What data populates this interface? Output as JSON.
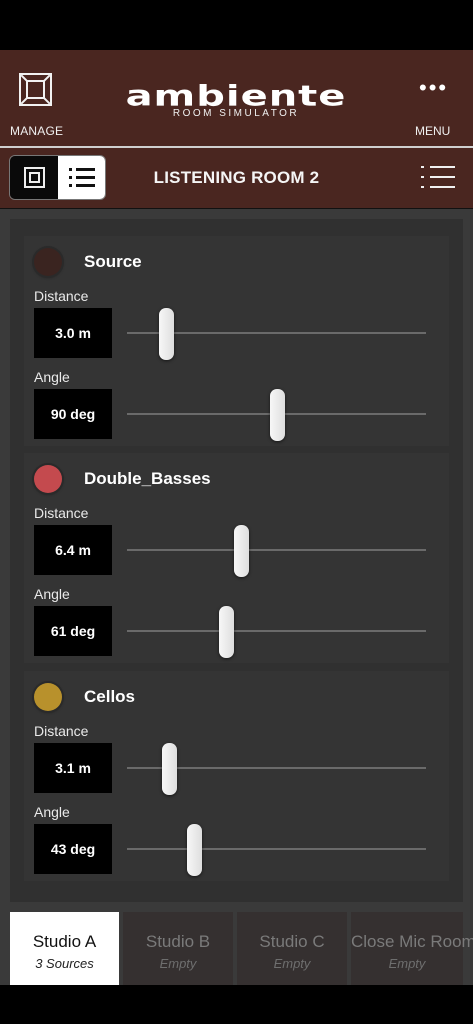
{
  "header": {
    "manage_label": "MANAGE",
    "logo_text": "ambiente",
    "logo_subtitle": "ROOM SIMULATOR",
    "menu_label": "MENU",
    "menu_glyph": "•••"
  },
  "room": {
    "title": "LISTENING ROOM 2"
  },
  "sources": [
    {
      "name": "Source",
      "color": "#3a2420",
      "distance": {
        "label": "Distance",
        "value": "3.0 m",
        "fraction": 0.13
      },
      "angle": {
        "label": "Angle",
        "value": "90 deg",
        "fraction": 0.5
      }
    },
    {
      "name": "Double_Basses",
      "color": "#c44a4e",
      "distance": {
        "label": "Distance",
        "value": "6.4 m",
        "fraction": 0.38
      },
      "angle": {
        "label": "Angle",
        "value": "61 deg",
        "fraction": 0.33
      }
    },
    {
      "name": "Cellos",
      "color": "#b8912c",
      "distance": {
        "label": "Distance",
        "value": "3.1 m",
        "fraction": 0.14
      },
      "angle": {
        "label": "Angle",
        "value": "43 deg",
        "fraction": 0.225
      }
    }
  ],
  "tabs": [
    {
      "name": "Studio A",
      "sub": "3 Sources",
      "active": true
    },
    {
      "name": "Studio B",
      "sub": "Empty",
      "active": false
    },
    {
      "name": "Studio C",
      "sub": "Empty",
      "active": false
    },
    {
      "name": "Close Mic Room",
      "sub": "Empty",
      "active": false
    }
  ],
  "icons": {
    "manage": "room-square-icon",
    "menu": "ellipsis-icon",
    "view_room": "room-view-icon",
    "view_list": "list-view-icon",
    "room_list": "list-icon"
  }
}
